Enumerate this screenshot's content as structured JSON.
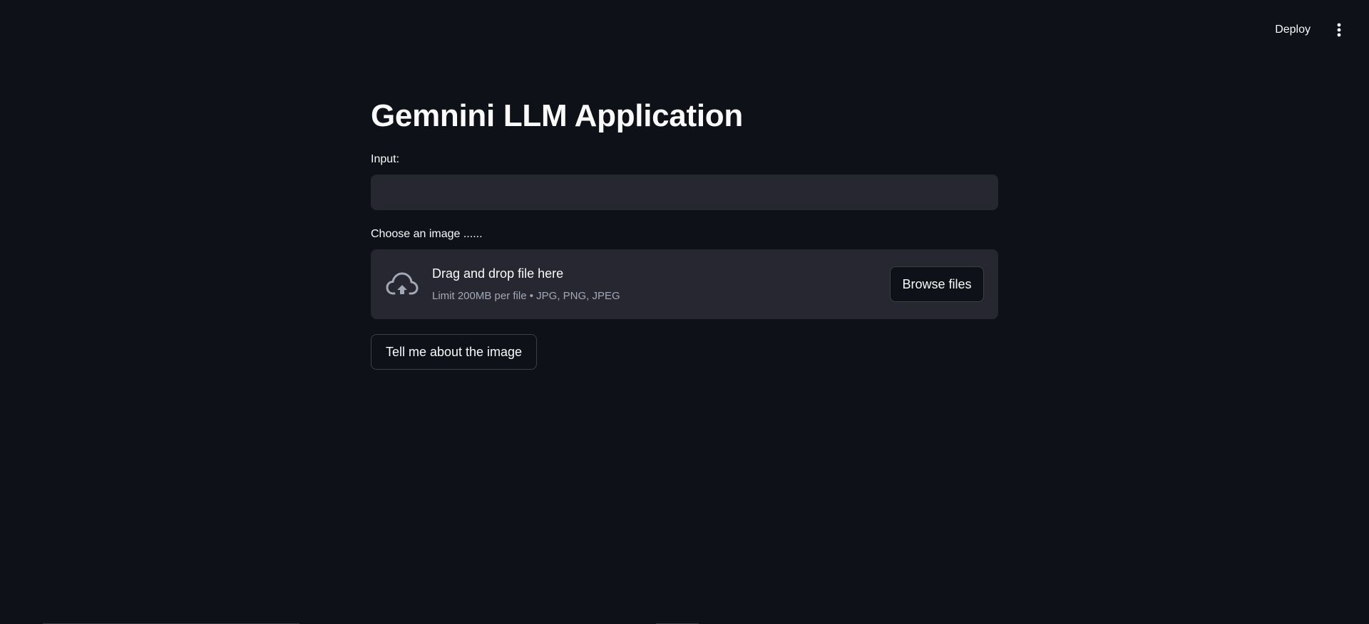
{
  "header": {
    "deploy_label": "Deploy",
    "menu_icon": "vertical-ellipsis-icon"
  },
  "main": {
    "title": "Gemnini LLM Application",
    "input": {
      "label": "Input:",
      "value": "",
      "placeholder": ""
    },
    "uploader": {
      "label": "Choose an image ......",
      "icon": "cloud-upload-icon",
      "drop_text": "Drag and drop file here",
      "limit_text": "Limit 200MB per file • JPG, PNG, JPEG",
      "browse_label": "Browse files"
    },
    "submit_label": "Tell me about the image"
  },
  "colors": {
    "background": "#0e1117",
    "surface": "#262730",
    "text": "#fafafa",
    "muted_text": "#a3a8b8"
  }
}
